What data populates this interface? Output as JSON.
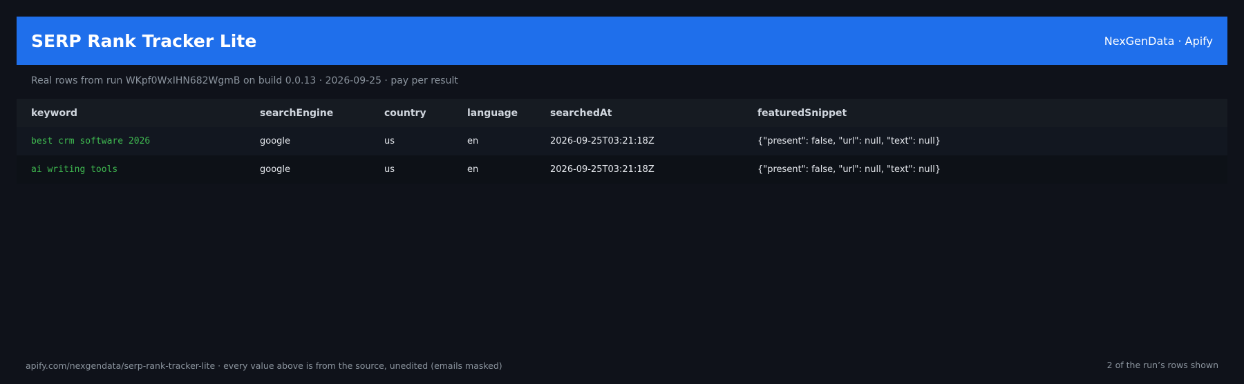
{
  "header": {
    "title": "SERP Rank Tracker Lite",
    "brand": "NexGenData · Apify"
  },
  "subtitle": "Real rows from run WKpf0WxIHN682WgmB on build 0.0.13 · 2026-09-25 · pay per result",
  "table": {
    "columns": [
      "keyword",
      "searchEngine",
      "country",
      "language",
      "searchedAt",
      "featuredSnippet"
    ],
    "rows": [
      {
        "keyword": "best crm software 2026",
        "searchEngine": "google",
        "country": "us",
        "language": "en",
        "searchedAt": "2026-09-25T03:21:18Z",
        "featuredSnippet": "{\"present\": false, \"url\": null, \"text\": null}"
      },
      {
        "keyword": "ai writing tools",
        "searchEngine": "google",
        "country": "us",
        "language": "en",
        "searchedAt": "2026-09-25T03:21:18Z",
        "featuredSnippet": "{\"present\": false, \"url\": null, \"text\": null}"
      }
    ]
  },
  "footer": {
    "left": "apify.com/nexgendata/serp-rank-tracker-lite  ·  every value above is from the source, unedited (emails masked)",
    "right": "2 of the run’s rows shown"
  },
  "colors": {
    "background": "#0f121a",
    "header": "#1f6feb",
    "keyword": "#3fb950",
    "muted": "#8b949e"
  }
}
